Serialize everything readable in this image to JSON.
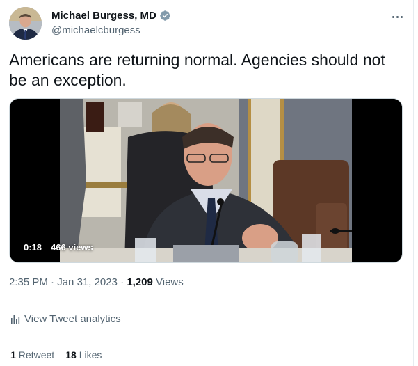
{
  "author": {
    "display_name": "Michael Burgess, MD",
    "handle": "@michaelcburgess",
    "verified_icon": "verified-badge-icon",
    "verified_color": "#829aab"
  },
  "tweet": {
    "text": "Americans are returning normal. Agencies should not be an exception."
  },
  "video": {
    "timestamp": "0:18",
    "views": "466 views"
  },
  "meta": {
    "time": "2:35 PM",
    "separator": " · ",
    "date": "Jan 31, 2023",
    "views_count": "1,209",
    "views_label": " Views"
  },
  "analytics": {
    "label": "View Tweet analytics",
    "icon": "bar-chart-icon"
  },
  "stats": {
    "retweets_count": "1",
    "retweets_label": "Retweet",
    "likes_count": "18",
    "likes_label": "Likes"
  },
  "colors": {
    "text_primary": "#0f1419",
    "text_secondary": "#536471",
    "divider": "#eff3f4"
  }
}
